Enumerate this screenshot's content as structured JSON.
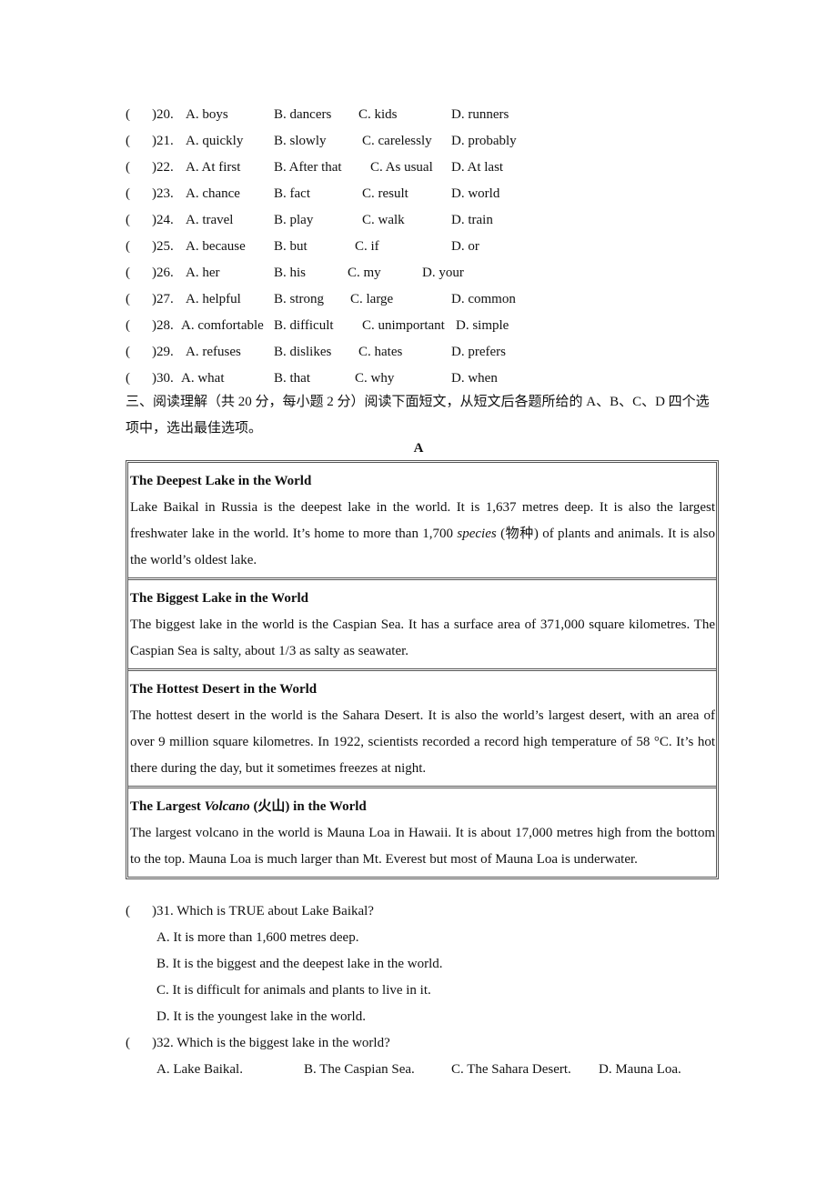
{
  "cloze": [
    {
      "num": ")20.",
      "options": [
        "A. boys",
        "B. dancers",
        "C. kids",
        "D. runners"
      ]
    },
    {
      "num": ")21.",
      "options": [
        "A. quickly",
        "B. slowly",
        "C. carelessly",
        "D. probably"
      ]
    },
    {
      "num": ")22.",
      "options": [
        "A. At first",
        "B. After that",
        "C. As usual",
        "D. At last"
      ]
    },
    {
      "num": ")23.",
      "options": [
        "A. chance",
        "B. fact",
        "C. result",
        "D. world"
      ]
    },
    {
      "num": ")24.",
      "options": [
        "A. travel",
        "B. play",
        "C. walk",
        "D. train"
      ]
    },
    {
      "num": ")25.",
      "options": [
        "A. because",
        "B. but",
        "C. if",
        "D. or"
      ]
    },
    {
      "num": ")26.",
      "options": [
        "A. her",
        "B. his",
        "C. my",
        "D. your"
      ]
    },
    {
      "num": ")27.",
      "options": [
        "A. helpful",
        "B. strong",
        "C. large",
        "D. common"
      ]
    },
    {
      "num": ")28.",
      "options": [
        "A. comfortable",
        "B. difficult",
        "C. unimportant",
        "D. simple"
      ]
    },
    {
      "num": ")29.",
      "options": [
        "A. refuses",
        "B. dislikes",
        "C. hates",
        "D. prefers"
      ]
    },
    {
      "num": ")30.",
      "options": [
        "A. what",
        "B. that",
        "C. why",
        "D. when"
      ]
    }
  ],
  "paren": "(",
  "section": {
    "intro": "三、阅读理解（共 20 分，每小题 2 分）阅读下面短文，从短文后各题所给的 A、B、C、D 四个选项中，选出最佳选项。",
    "passage_label": "A"
  },
  "passage": [
    {
      "title": "The Deepest Lake in the World",
      "body_pre": "Lake Baikal in Russia is the deepest lake in the world. It is 1,637 metres deep. It is also the largest freshwater lake in the world. It’s home to more than 1,700 ",
      "body_em": "species",
      "body_post": " (物种) of plants and animals. It is also the world’s oldest lake."
    },
    {
      "title": "The Biggest Lake in the World",
      "body": "The biggest lake in the world is the Caspian Sea. It has a surface area of 371,000 square kilometres. The Caspian Sea is salty, about 1/3 as salty as seawater."
    },
    {
      "title": "The Hottest Desert in the World",
      "body": "The hottest desert in the world is the Sahara Desert. It is also the world’s largest desert, with an area of over 9 million square kilometres. In 1922, scientists recorded a record high temperature of 58 °C. It’s hot there during the day, but it sometimes freezes at night."
    },
    {
      "title_pre": "The Largest ",
      "title_em": "Volcano",
      "title_post": " (火山) in the World",
      "body": "The largest volcano in the world is Mauna Loa in Hawaii. It is about 17,000 metres high from the bottom to the top. Mauna Loa is much larger than Mt. Everest but most of Mauna Loa is underwater."
    }
  ],
  "questions": [
    {
      "stem": ")31. Which is TRUE about Lake Baikal?",
      "options": [
        "A. It is more than 1,600 metres deep.",
        "B. It is the biggest and the deepest lake in the world.",
        "C. It is difficult for animals and plants to live in it.",
        "D. It is the youngest lake in the world."
      ]
    },
    {
      "stem": ")32. Which is the biggest lake in the world?",
      "options": [
        "A. Lake Baikal.",
        "B. The Caspian Sea.",
        "C. The Sahara Desert.",
        "D. Mauna Loa."
      ]
    }
  ]
}
